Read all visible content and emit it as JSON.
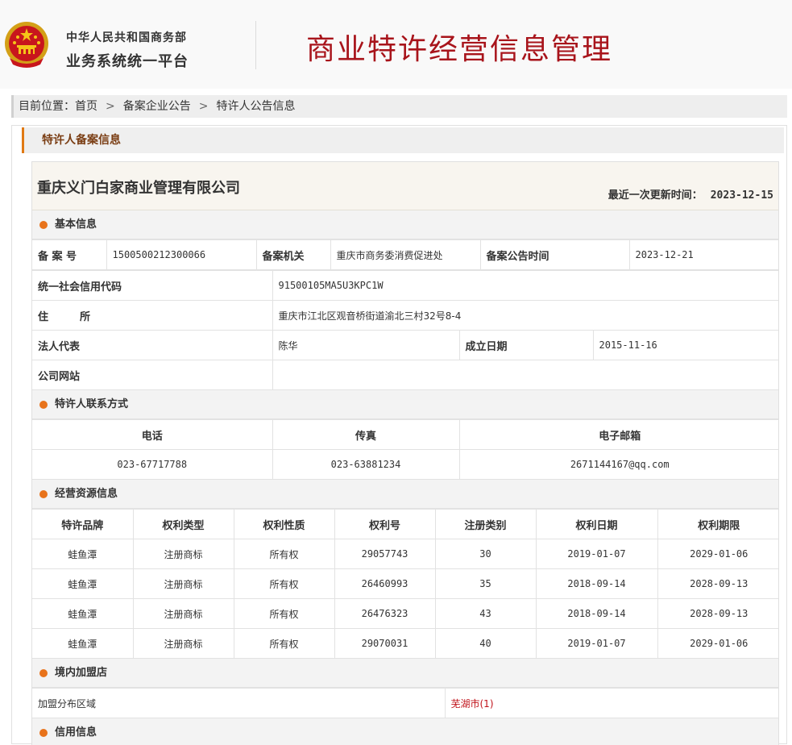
{
  "header": {
    "org_line1": "中华人民共和国商务部",
    "org_line2": "业务系统统一平台",
    "system_title": "商业特许经营信息管理"
  },
  "breadcrumb": {
    "prefix": "目前位置：",
    "items": [
      "首页",
      "备案企业公告",
      "特许人公告信息"
    ],
    "separator": ">"
  },
  "tab_title": "特许人备案信息",
  "company": {
    "name": "重庆义门白家商业管理有限公司",
    "updated_label": "最近一次更新时间：",
    "updated_value": "2023-12-15"
  },
  "basic": {
    "section_title": "基本信息",
    "filing_no_label": "备 案 号",
    "filing_no": "1500500212300066",
    "authority_label": "备案机关",
    "authority": "重庆市商务委消费促进处",
    "announce_time_label": "备案公告时间",
    "announce_time": "2023-12-21",
    "credit_code_label": "统一社会信用代码",
    "credit_code": "91500105MA5U3KPC1W",
    "address_label": "住　　　所",
    "address": "重庆市江北区观音桥街道渝北三村32号8-4",
    "legal_rep_label": "法人代表",
    "legal_rep": "陈华",
    "established_label": "成立日期",
    "established": "2015-11-16",
    "website_label": "公司网站",
    "website": ""
  },
  "contact": {
    "section_title": "特许人联系方式",
    "headers": [
      "电话",
      "传真",
      "电子邮箱"
    ],
    "phone": "023-67717788",
    "fax": "023-63881234",
    "email": "2671144167@qq.com"
  },
  "resources": {
    "section_title": "经营资源信息",
    "headers": [
      "特许品牌",
      "权利类型",
      "权利性质",
      "权利号",
      "注册类别",
      "权利日期",
      "权利期限"
    ],
    "rows": [
      [
        "蛙鱼潭",
        "注册商标",
        "所有权",
        "29057743",
        "30",
        "2019-01-07",
        "2029-01-06"
      ],
      [
        "蛙鱼潭",
        "注册商标",
        "所有权",
        "26460993",
        "35",
        "2018-09-14",
        "2028-09-13"
      ],
      [
        "蛙鱼潭",
        "注册商标",
        "所有权",
        "26476323",
        "43",
        "2018-09-14",
        "2028-09-13"
      ],
      [
        "蛙鱼潭",
        "注册商标",
        "所有权",
        "29070031",
        "40",
        "2019-01-07",
        "2029-01-06"
      ]
    ]
  },
  "franchise": {
    "section_title": "境内加盟店",
    "region_label": "加盟分布区域",
    "region_value": "芜湖市(1)"
  },
  "credit": {
    "section_title": "信用信息"
  },
  "colors": {
    "title_red": "#a8141b",
    "accent_orange": "#e8731b",
    "link_red": "#c0121a"
  }
}
